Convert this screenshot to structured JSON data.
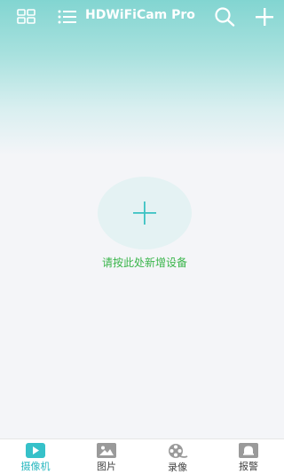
{
  "header": {
    "title": "HDWiFiCam Pro",
    "icons": [
      "grid-icon",
      "list-icon",
      "search-icon",
      "plus-icon"
    ]
  },
  "main": {
    "add_icon": "plus-icon",
    "add_label": "请按此处新增设备"
  },
  "tabbar": {
    "active_index": 0,
    "accent_color": "#2ab8c0",
    "tabs": [
      {
        "label": "摄像机",
        "icon": "play-icon"
      },
      {
        "label": "图片",
        "icon": "image-icon"
      },
      {
        "label": "录像",
        "icon": "film-reel-icon"
      },
      {
        "label": "报警",
        "icon": "bell-icon"
      }
    ]
  }
}
